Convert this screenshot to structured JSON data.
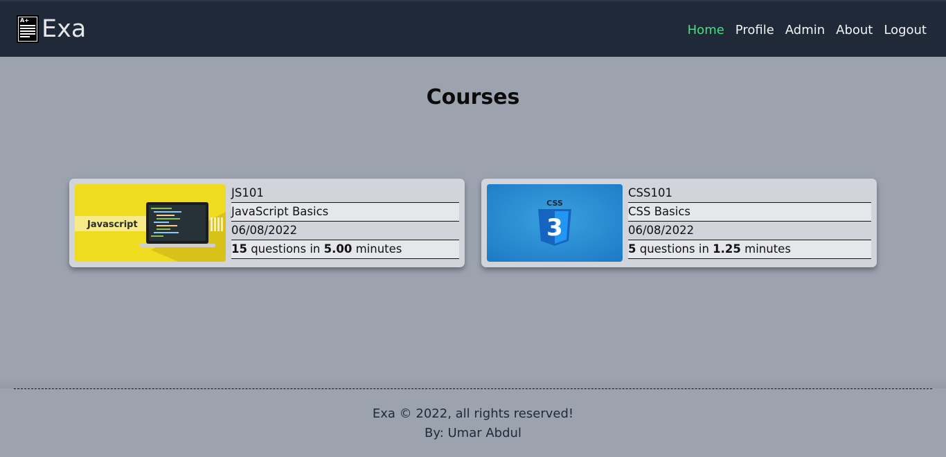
{
  "header": {
    "brand": "Exa",
    "logo_icon": "exam-paper-icon",
    "nav": [
      {
        "label": "Home",
        "active": true
      },
      {
        "label": "Profile",
        "active": false
      },
      {
        "label": "Admin",
        "active": false
      },
      {
        "label": "About",
        "active": false
      },
      {
        "label": "Logout",
        "active": false
      }
    ],
    "active_color": "#4ade80"
  },
  "main": {
    "title": "Courses",
    "courses": [
      {
        "code": "JS101",
        "name": "JavaScript Basics",
        "date": "06/08/2022",
        "questions": "15",
        "questions_text": " questions in ",
        "minutes": "5.00",
        "minutes_text": " minutes",
        "thumbnail_label": "Javascript",
        "thumbnail_icon": "javascript-laptop-image"
      },
      {
        "code": "CSS101",
        "name": "CSS Basics",
        "date": "06/08/2022",
        "questions": "5",
        "questions_text": " questions in ",
        "minutes": "1.25",
        "minutes_text": " minutes",
        "thumbnail_label": "CSS",
        "thumbnail_icon": "css3-logo-image"
      }
    ]
  },
  "footer": {
    "copyright": "Exa © 2022, all rights reserved!",
    "author": "By: Umar Abdul"
  },
  "colors": {
    "navbar_bg": "#1f2937",
    "page_bg": "#9ca3af",
    "card_bg": "#d1d5db"
  }
}
